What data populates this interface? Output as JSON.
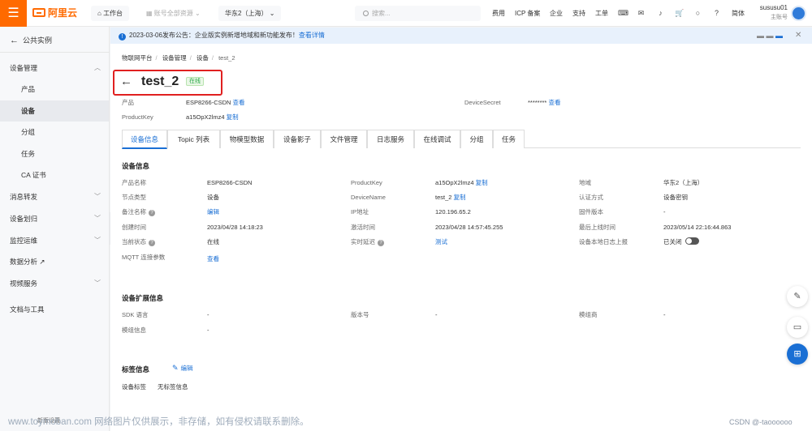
{
  "topbar": {
    "logo_text": "阿里云",
    "workbench": "工作台",
    "account_resources": "账号全部资源",
    "region": "华东2（上海）",
    "search_placeholder": "搜索...",
    "nav": [
      "费用",
      "ICP 备案",
      "企业",
      "支持",
      "工单"
    ],
    "lang": "简体",
    "user_name": "sususu01",
    "user_role": "主账号"
  },
  "sidebar": {
    "back_label": "公共实例",
    "items": [
      {
        "label": "设备管理",
        "type": "group",
        "chevron": "up"
      },
      {
        "label": "产品",
        "type": "sub"
      },
      {
        "label": "设备",
        "type": "sub",
        "active": true
      },
      {
        "label": "分组",
        "type": "sub"
      },
      {
        "label": "任务",
        "type": "sub"
      },
      {
        "label": "CA 证书",
        "type": "sub"
      },
      {
        "label": "消息转发",
        "type": "group",
        "chevron": "down"
      },
      {
        "label": "设备划归",
        "type": "group",
        "chevron": "down"
      },
      {
        "label": "监控运维",
        "type": "group",
        "chevron": "down"
      },
      {
        "label": "数据分析 ↗",
        "type": "group"
      },
      {
        "label": "视频服务",
        "type": "group",
        "chevron": "down"
      },
      {
        "label": "文档与工具",
        "type": "group"
      }
    ],
    "bottom_hint": "新版设置"
  },
  "notice": {
    "text": "2023-03-06发布公告：企业版实例新增地域和新功能发布！",
    "link": "查看详情"
  },
  "breadcrumb": [
    "物联网平台",
    "设备管理",
    "设备",
    "test_2"
  ],
  "device": {
    "name": "test_2",
    "status": "在线",
    "product_label": "产品",
    "product_value": "ESP8266-CSDN",
    "product_link": "查看",
    "productkey_label": "ProductKey",
    "productkey_value": "a15OpX2lmz4",
    "productkey_link": "复制",
    "devicesecret_label": "DeviceSecret",
    "devicesecret_value": "********",
    "devicesecret_link": "查看"
  },
  "tabs": [
    "设备信息",
    "Topic 列表",
    "物模型数据",
    "设备影子",
    "文件管理",
    "日志服务",
    "在线调试",
    "分组",
    "任务"
  ],
  "device_info": {
    "section_title": "设备信息",
    "rows": [
      [
        {
          "label": "产品名称",
          "value": "ESP8266-CSDN"
        },
        {
          "label": "ProductKey",
          "value": "a15OpX2lmz4",
          "link": "复制"
        },
        {
          "label": "地域",
          "value": "华东2（上海）"
        }
      ],
      [
        {
          "label": "节点类型",
          "value": "设备"
        },
        {
          "label": "DeviceName",
          "value": "test_2",
          "link": "复制"
        },
        {
          "label": "认证方式",
          "value": "设备密钥"
        }
      ],
      [
        {
          "label": "备注名称",
          "value": "编辑",
          "is_link": true
        },
        {
          "label": "IP地址",
          "value": "120.196.65.2"
        },
        {
          "label": "固件版本",
          "value": "-"
        }
      ],
      [
        {
          "label": "创建时间",
          "value": "2023/04/28 14:18:23"
        },
        {
          "label": "激活时间",
          "value": "2023/04/28 14:57:45.255"
        },
        {
          "label": "最后上线时间",
          "value": "2023/05/14 22:16:44.863"
        }
      ],
      [
        {
          "label": "当前状态",
          "value": "在线"
        },
        {
          "label": "实时延迟",
          "value": "测试",
          "is_link": true
        },
        {
          "label": "设备本地日志上报",
          "value": "已关闭"
        }
      ],
      [
        {
          "label": "MQTT 连接参数",
          "value": "查看",
          "is_link": true
        }
      ]
    ]
  },
  "ext_info": {
    "section_title": "设备扩展信息",
    "rows": [
      [
        {
          "label": "SDK 语言",
          "value": "-"
        },
        {
          "label": "版本号",
          "value": "-"
        },
        {
          "label": "模组商",
          "value": "-"
        }
      ],
      [
        {
          "label": "模组信息",
          "value": "-"
        }
      ]
    ]
  },
  "tag_info": {
    "section_title": "标签信息",
    "edit_link": "编辑",
    "label": "设备标签",
    "value": "无标签信息"
  },
  "watermark": {
    "left": "www.toymoban.com 网络图片仅供展示，非存储，如有侵权请联系删除。",
    "right": "CSDN @-taoooooo"
  },
  "colors": {
    "brand": "#ff6a00",
    "link": "#1a6fd4",
    "highlight_box": "#e02020",
    "status_green": "#28a745"
  }
}
